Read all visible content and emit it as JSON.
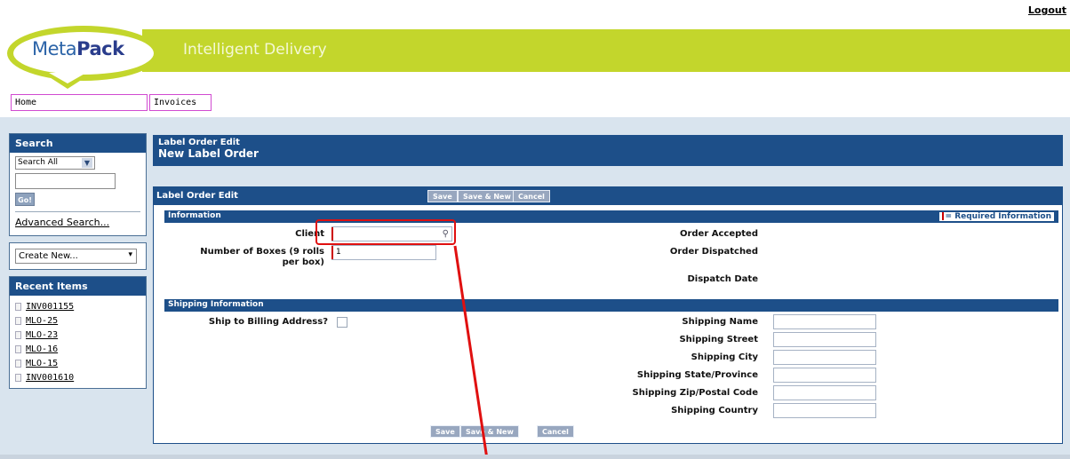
{
  "header": {
    "logout": "Logout",
    "logo_meta": "Meta",
    "logo_pack": "Pack",
    "tagline": "Intelligent Delivery"
  },
  "tabs": {
    "home": "Home",
    "invoices": "Invoices"
  },
  "sidebar": {
    "search_title": "Search",
    "search_scope": "Search All",
    "go": "Go!",
    "advanced": "Advanced Search...",
    "create_new": "Create New...",
    "recent_title": "Recent Items",
    "recent": [
      "INV001155",
      "MLO-25",
      "MLO-23",
      "MLO-16",
      "MLO-15",
      "INV001610"
    ]
  },
  "page": {
    "title_small": "Label Order Edit",
    "title_large": "New Label Order"
  },
  "form": {
    "panel_title": "Label Order Edit",
    "buttons": {
      "save": "Save",
      "save_new": "Save & New",
      "cancel": "Cancel"
    },
    "information_title": "Information",
    "required_info": "= Required Information",
    "client_label": "Client",
    "client_value": "",
    "boxes_label_1": "Number of Boxes (9 rolls",
    "boxes_label_2": "per box)",
    "boxes_value": "1",
    "order_accepted": "Order Accepted",
    "order_dispatched": "Order Dispatched",
    "dispatch_date": "Dispatch Date",
    "shipping_title": "Shipping Information",
    "ship_to_billing": "Ship to Billing Address?",
    "shipping_fields": [
      "Shipping Name",
      "Shipping Street",
      "Shipping City",
      "Shipping State/Province",
      "Shipping Zip/Postal Code",
      "Shipping Country"
    ]
  },
  "colors": {
    "brand_green": "#c3d62c",
    "brand_blue": "#1d4f89",
    "annotation_red": "#e01010"
  }
}
